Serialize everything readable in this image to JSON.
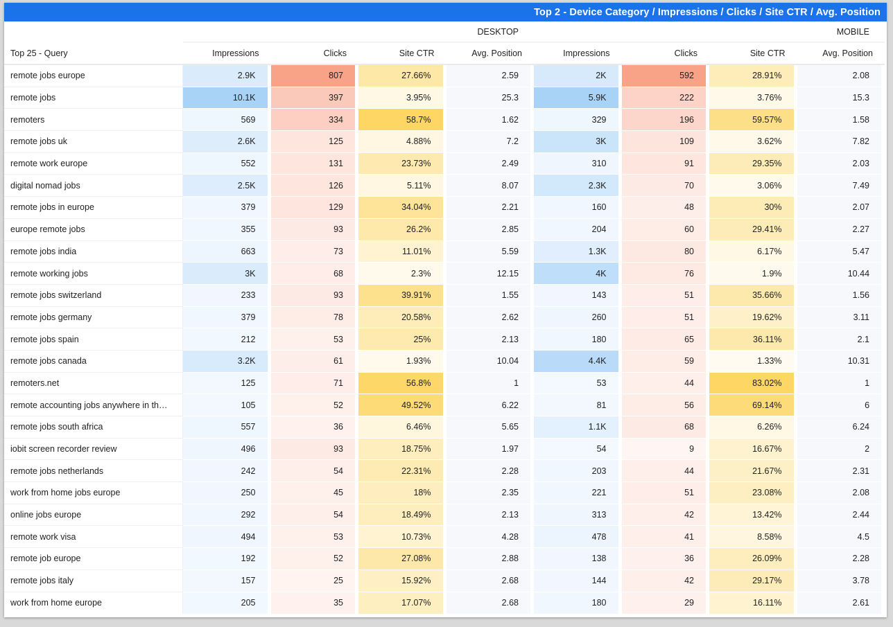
{
  "title": "Top 2 - Device Category / Impressions / Clicks / Site CTR / Avg. Position",
  "devices": [
    "DESKTOP",
    "MOBILE"
  ],
  "columns": {
    "query": "Top 25 - Query",
    "metrics": [
      "Impressions",
      "Clicks",
      "Site CTR",
      "Avg. Position"
    ]
  },
  "colors": {
    "title_bar": "#1a73e8",
    "impressions_heat": "#a8d3f7",
    "clicks_heat": "#f8a287",
    "ctr_heat": "#fdd663"
  },
  "rows": [
    {
      "query": "remote jobs europe",
      "desktop": {
        "impressions": "2.9K",
        "clicks": "807",
        "ctr": "27.66%",
        "position": "2.59"
      },
      "mobile": {
        "impressions": "2K",
        "clicks": "592",
        "ctr": "28.91%",
        "position": "2.08"
      }
    },
    {
      "query": "remote jobs",
      "desktop": {
        "impressions": "10.1K",
        "clicks": "397",
        "ctr": "3.95%",
        "position": "25.3"
      },
      "mobile": {
        "impressions": "5.9K",
        "clicks": "222",
        "ctr": "3.76%",
        "position": "15.3"
      }
    },
    {
      "query": "remoters",
      "desktop": {
        "impressions": "569",
        "clicks": "334",
        "ctr": "58.7%",
        "position": "1.62"
      },
      "mobile": {
        "impressions": "329",
        "clicks": "196",
        "ctr": "59.57%",
        "position": "1.58"
      }
    },
    {
      "query": "remote jobs uk",
      "desktop": {
        "impressions": "2.6K",
        "clicks": "125",
        "ctr": "4.88%",
        "position": "7.2"
      },
      "mobile": {
        "impressions": "3K",
        "clicks": "109",
        "ctr": "3.62%",
        "position": "7.82"
      }
    },
    {
      "query": "remote work europe",
      "desktop": {
        "impressions": "552",
        "clicks": "131",
        "ctr": "23.73%",
        "position": "2.49"
      },
      "mobile": {
        "impressions": "310",
        "clicks": "91",
        "ctr": "29.35%",
        "position": "2.03"
      }
    },
    {
      "query": "digital nomad jobs",
      "desktop": {
        "impressions": "2.5K",
        "clicks": "126",
        "ctr": "5.11%",
        "position": "8.07"
      },
      "mobile": {
        "impressions": "2.3K",
        "clicks": "70",
        "ctr": "3.06%",
        "position": "7.49"
      }
    },
    {
      "query": "remote jobs in europe",
      "desktop": {
        "impressions": "379",
        "clicks": "129",
        "ctr": "34.04%",
        "position": "2.21"
      },
      "mobile": {
        "impressions": "160",
        "clicks": "48",
        "ctr": "30%",
        "position": "2.07"
      }
    },
    {
      "query": "europe remote jobs",
      "desktop": {
        "impressions": "355",
        "clicks": "93",
        "ctr": "26.2%",
        "position": "2.85"
      },
      "mobile": {
        "impressions": "204",
        "clicks": "60",
        "ctr": "29.41%",
        "position": "2.27"
      }
    },
    {
      "query": "remote jobs india",
      "desktop": {
        "impressions": "663",
        "clicks": "73",
        "ctr": "11.01%",
        "position": "5.59"
      },
      "mobile": {
        "impressions": "1.3K",
        "clicks": "80",
        "ctr": "6.17%",
        "position": "5.47"
      }
    },
    {
      "query": "remote working jobs",
      "desktop": {
        "impressions": "3K",
        "clicks": "68",
        "ctr": "2.3%",
        "position": "12.15"
      },
      "mobile": {
        "impressions": "4K",
        "clicks": "76",
        "ctr": "1.9%",
        "position": "10.44"
      }
    },
    {
      "query": "remote jobs switzerland",
      "desktop": {
        "impressions": "233",
        "clicks": "93",
        "ctr": "39.91%",
        "position": "1.55"
      },
      "mobile": {
        "impressions": "143",
        "clicks": "51",
        "ctr": "35.66%",
        "position": "1.56"
      }
    },
    {
      "query": "remote jobs germany",
      "desktop": {
        "impressions": "379",
        "clicks": "78",
        "ctr": "20.58%",
        "position": "2.62"
      },
      "mobile": {
        "impressions": "260",
        "clicks": "51",
        "ctr": "19.62%",
        "position": "3.11"
      }
    },
    {
      "query": "remote jobs spain",
      "desktop": {
        "impressions": "212",
        "clicks": "53",
        "ctr": "25%",
        "position": "2.13"
      },
      "mobile": {
        "impressions": "180",
        "clicks": "65",
        "ctr": "36.11%",
        "position": "2.1"
      }
    },
    {
      "query": "remote jobs canada",
      "desktop": {
        "impressions": "3.2K",
        "clicks": "61",
        "ctr": "1.93%",
        "position": "10.04"
      },
      "mobile": {
        "impressions": "4.4K",
        "clicks": "59",
        "ctr": "1.33%",
        "position": "10.31"
      }
    },
    {
      "query": "remoters.net",
      "desktop": {
        "impressions": "125",
        "clicks": "71",
        "ctr": "56.8%",
        "position": "1"
      },
      "mobile": {
        "impressions": "53",
        "clicks": "44",
        "ctr": "83.02%",
        "position": "1"
      }
    },
    {
      "query": "remote accounting jobs anywhere in th…",
      "desktop": {
        "impressions": "105",
        "clicks": "52",
        "ctr": "49.52%",
        "position": "6.22"
      },
      "mobile": {
        "impressions": "81",
        "clicks": "56",
        "ctr": "69.14%",
        "position": "6"
      }
    },
    {
      "query": "remote jobs south africa",
      "desktop": {
        "impressions": "557",
        "clicks": "36",
        "ctr": "6.46%",
        "position": "5.65"
      },
      "mobile": {
        "impressions": "1.1K",
        "clicks": "68",
        "ctr": "6.26%",
        "position": "6.24"
      }
    },
    {
      "query": "iobit screen recorder review",
      "desktop": {
        "impressions": "496",
        "clicks": "93",
        "ctr": "18.75%",
        "position": "1.97"
      },
      "mobile": {
        "impressions": "54",
        "clicks": "9",
        "ctr": "16.67%",
        "position": "2"
      }
    },
    {
      "query": "remote jobs netherlands",
      "desktop": {
        "impressions": "242",
        "clicks": "54",
        "ctr": "22.31%",
        "position": "2.28"
      },
      "mobile": {
        "impressions": "203",
        "clicks": "44",
        "ctr": "21.67%",
        "position": "2.31"
      }
    },
    {
      "query": "work from home jobs europe",
      "desktop": {
        "impressions": "250",
        "clicks": "45",
        "ctr": "18%",
        "position": "2.35"
      },
      "mobile": {
        "impressions": "221",
        "clicks": "51",
        "ctr": "23.08%",
        "position": "2.08"
      }
    },
    {
      "query": "online jobs europe",
      "desktop": {
        "impressions": "292",
        "clicks": "54",
        "ctr": "18.49%",
        "position": "2.13"
      },
      "mobile": {
        "impressions": "313",
        "clicks": "42",
        "ctr": "13.42%",
        "position": "2.44"
      }
    },
    {
      "query": "remote work visa",
      "desktop": {
        "impressions": "494",
        "clicks": "53",
        "ctr": "10.73%",
        "position": "4.28"
      },
      "mobile": {
        "impressions": "478",
        "clicks": "41",
        "ctr": "8.58%",
        "position": "4.5"
      }
    },
    {
      "query": "remote job europe",
      "desktop": {
        "impressions": "192",
        "clicks": "52",
        "ctr": "27.08%",
        "position": "2.88"
      },
      "mobile": {
        "impressions": "138",
        "clicks": "36",
        "ctr": "26.09%",
        "position": "2.28"
      }
    },
    {
      "query": "remote jobs italy",
      "desktop": {
        "impressions": "157",
        "clicks": "25",
        "ctr": "15.92%",
        "position": "2.68"
      },
      "mobile": {
        "impressions": "144",
        "clicks": "42",
        "ctr": "29.17%",
        "position": "3.78"
      }
    },
    {
      "query": "work from home europe",
      "desktop": {
        "impressions": "205",
        "clicks": "35",
        "ctr": "17.07%",
        "position": "2.68"
      },
      "mobile": {
        "impressions": "180",
        "clicks": "29",
        "ctr": "16.11%",
        "position": "2.61"
      }
    }
  ]
}
